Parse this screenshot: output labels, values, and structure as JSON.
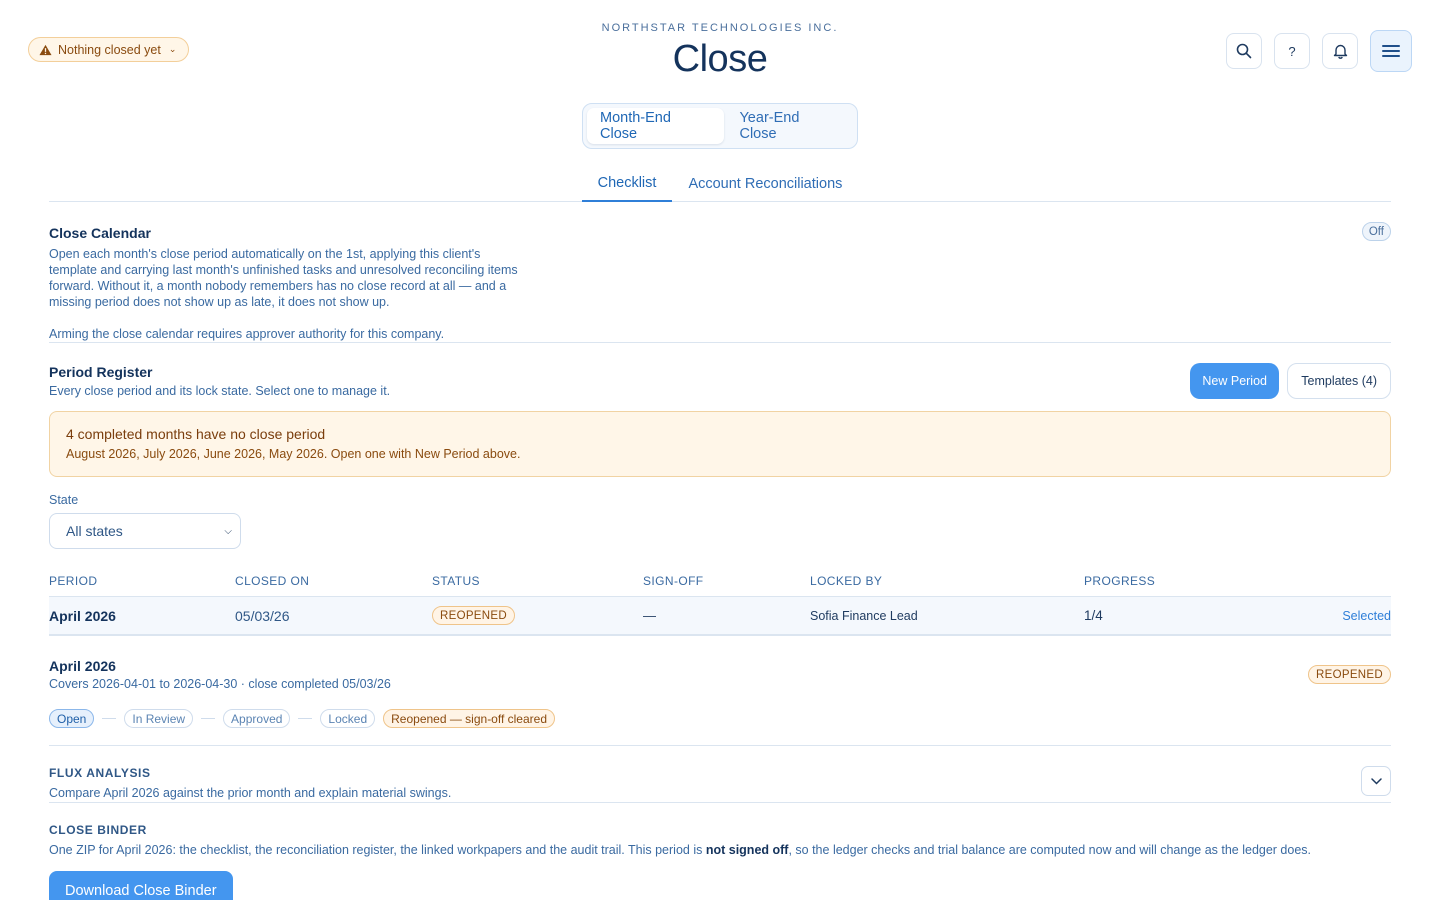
{
  "header": {
    "status_pill": "Nothing closed yet",
    "company": "NORTHSTAR TECHNOLOGIES INC.",
    "title": "Close",
    "help_label": "?"
  },
  "modes": [
    {
      "label": "Month-End Close",
      "active": true
    },
    {
      "label": "Year-End Close",
      "active": false
    }
  ],
  "tabs": [
    {
      "label": "Checklist",
      "active": true
    },
    {
      "label": "Account Reconciliations",
      "active": false
    }
  ],
  "close_calendar": {
    "title": "Close Calendar",
    "description": "Open each month's close period automatically on the 1st, applying this client's template and carrying last month's unfinished tasks and unresolved reconciling items forward. Without it, a month nobody remembers has no close record at all — and a missing period does not show up as late, it does not show up.",
    "note": "Arming the close calendar requires approver authority for this company.",
    "toggle": "Off"
  },
  "period_register": {
    "title": "Period Register",
    "subtitle": "Every close period and its lock state. Select one to manage it.",
    "new_button": "New Period",
    "templates_button": "Templates (4)"
  },
  "alert": {
    "title": "4 completed months have no close period",
    "text": "August 2026, July 2026, June 2026, May 2026. Open one with New Period above."
  },
  "filter": {
    "label": "State",
    "value": "All states"
  },
  "table": {
    "headers": [
      "PERIOD",
      "CLOSED ON",
      "STATUS",
      "SIGN-OFF",
      "LOCKED BY",
      "PROGRESS"
    ],
    "rows": [
      {
        "period": "April 2026",
        "closed_on": "05/03/26",
        "status": "REOPENED",
        "sign_off": "—",
        "locked_by": "Sofia Finance Lead",
        "progress": "1/4",
        "action": "Selected"
      }
    ]
  },
  "detail": {
    "title": "April 2026",
    "subtitle": "Covers 2026-04-01 to 2026-04-30 · close completed 05/03/26",
    "badge": "REOPENED",
    "steps": [
      "Open",
      "In Review",
      "Approved",
      "Locked",
      "Reopened — sign-off cleared"
    ]
  },
  "flux": {
    "title": "FLUX ANALYSIS",
    "text": "Compare April 2026 against the prior month and explain material swings."
  },
  "binder": {
    "title": "CLOSE BINDER",
    "text_before": "One ZIP for April 2026: the checklist, the reconciliation register, the linked workpapers and the audit trail. This period is ",
    "text_bold": "not signed off",
    "text_after": ", so the ledger checks and trial balance are computed now and will change as the ledger does.",
    "button": "Download Close Binder"
  }
}
